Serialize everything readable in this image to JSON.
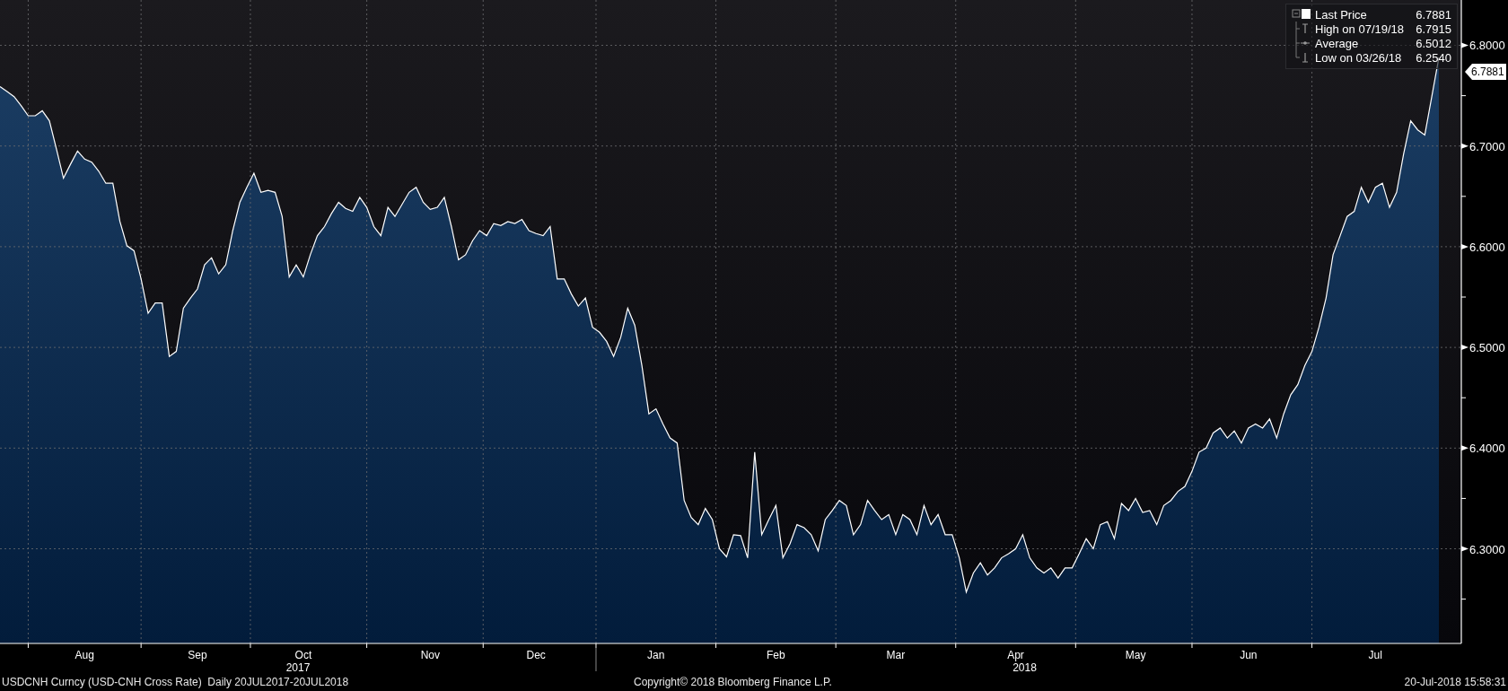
{
  "chart": {
    "legend": [
      {
        "kind": "last",
        "value": "6.7881"
      },
      {
        "kind": "high",
        "label": "High on 07/19/18",
        "value": "6.7915"
      },
      {
        "kind": "average",
        "label": "Average",
        "value": "6.5012"
      },
      {
        "kind": "low",
        "label": "Low on 03/26/18",
        "value": "6.2540"
      }
    ],
    "price_tag": "6.7881",
    "chart_data": {
      "type": "area",
      "grid": true,
      "ylim": [
        6.206,
        6.845
      ],
      "categories": [
        null,
        null,
        null,
        null,
        null,
        null,
        null,
        null,
        null,
        null,
        null,
        null,
        "Aug",
        null,
        null,
        null,
        null,
        null,
        null,
        null,
        null,
        null,
        null,
        null,
        null,
        null,
        null,
        null,
        "Sep",
        null,
        null,
        null,
        null,
        null,
        null,
        null,
        null,
        null,
        null,
        null,
        null,
        null,
        null,
        "Oct",
        null,
        null,
        null,
        null,
        null,
        null,
        null,
        null,
        null,
        null,
        null,
        null,
        null,
        null,
        null,
        null,
        null,
        "Nov",
        null,
        null,
        null,
        null,
        null,
        null,
        null,
        null,
        null,
        null,
        null,
        null,
        null,
        null,
        "Dec",
        null,
        null,
        null,
        null,
        null,
        null,
        null,
        null,
        null,
        null,
        null,
        null,
        null,
        null,
        null,
        null,
        "Jan",
        null,
        null,
        null,
        null,
        null,
        null,
        null,
        null,
        null,
        null,
        null,
        null,
        null,
        null,
        null,
        null,
        "Feb",
        null,
        null,
        null,
        null,
        null,
        null,
        null,
        null,
        null,
        null,
        null,
        null,
        null,
        null,
        null,
        null,
        "Mar",
        null,
        null,
        null,
        null,
        null,
        null,
        null,
        null,
        null,
        null,
        null,
        null,
        null,
        null,
        null,
        null,
        "Apr",
        null,
        null,
        null,
        null,
        null,
        null,
        null,
        null,
        null,
        null,
        null,
        null,
        null,
        null,
        null,
        null,
        "May",
        null,
        null,
        null,
        null,
        null,
        null,
        null,
        null,
        null,
        null,
        null,
        null,
        null,
        null,
        null,
        "Jun",
        null,
        null,
        null,
        null,
        null,
        null,
        null,
        null,
        null,
        null,
        null,
        null,
        null,
        null,
        null,
        null,
        null,
        "Jul",
        null,
        null,
        null,
        null,
        null,
        null,
        null,
        null,
        null
      ],
      "yticks": [
        {
          "value": 6.3,
          "label": "6.3000"
        },
        {
          "value": 6.4,
          "label": "6.4000"
        },
        {
          "value": 6.5,
          "label": "6.5000"
        },
        {
          "value": 6.6,
          "label": "6.6000"
        },
        {
          "value": 6.7,
          "label": "6.7000"
        },
        {
          "value": 6.8,
          "label": "6.8000"
        }
      ],
      "annotations": [
        "2017",
        "2018"
      ],
      "series": [
        {
          "name": "Last Price",
          "color": "#ffffff",
          "values": [
            6.759,
            6.754,
            6.749,
            6.74,
            6.73,
            6.73,
            6.735,
            6.725,
            6.697,
            6.668,
            6.682,
            6.695,
            6.687,
            6.684,
            6.675,
            6.663,
            6.663,
            6.625,
            6.601,
            6.596,
            6.568,
            6.534,
            6.544,
            6.544,
            6.491,
            6.496,
            6.539,
            6.549,
            6.558,
            6.582,
            6.589,
            6.573,
            6.582,
            6.616,
            6.644,
            6.659,
            6.673,
            6.654,
            6.656,
            6.654,
            6.63,
            6.57,
            6.582,
            6.57,
            6.592,
            6.611,
            6.62,
            6.633,
            6.644,
            6.638,
            6.635,
            6.649,
            6.639,
            6.62,
            6.611,
            6.639,
            6.63,
            6.642,
            6.654,
            6.659,
            6.644,
            6.637,
            6.639,
            6.649,
            6.62,
            6.587,
            6.592,
            6.606,
            6.616,
            6.611,
            6.623,
            6.621,
            6.625,
            6.623,
            6.627,
            6.616,
            6.613,
            6.611,
            6.62,
            6.568,
            6.568,
            6.553,
            6.541,
            6.549,
            6.52,
            6.515,
            6.506,
            6.491,
            6.51,
            6.539,
            6.522,
            6.482,
            6.434,
            6.439,
            6.424,
            6.41,
            6.405,
            6.348,
            6.331,
            6.324,
            6.34,
            6.329,
            6.3,
            6.292,
            6.314,
            6.313,
            6.291,
            6.396,
            6.314,
            6.329,
            6.343,
            6.291,
            6.305,
            6.324,
            6.321,
            6.314,
            6.298,
            6.329,
            6.338,
            6.348,
            6.343,
            6.314,
            6.324,
            6.348,
            6.338,
            6.329,
            6.334,
            6.314,
            6.334,
            6.329,
            6.314,
            6.343,
            6.324,
            6.334,
            6.314,
            6.314,
            6.291,
            6.257,
            6.276,
            6.286,
            6.274,
            6.281,
            6.291,
            6.295,
            6.3,
            6.314,
            6.291,
            6.281,
            6.276,
            6.281,
            6.271,
            6.281,
            6.281,
            6.295,
            6.31,
            6.3,
            6.324,
            6.327,
            6.31,
            6.345,
            6.338,
            6.35,
            6.336,
            6.338,
            6.324,
            6.343,
            6.348,
            6.357,
            6.362,
            6.377,
            6.396,
            6.4,
            6.415,
            6.42,
            6.41,
            6.417,
            6.405,
            6.42,
            6.424,
            6.42,
            6.429,
            6.41,
            6.434,
            6.453,
            6.463,
            6.482,
            6.496,
            6.52,
            6.549,
            6.592,
            6.611,
            6.63,
            6.635,
            6.659,
            6.644,
            6.659,
            6.663,
            6.639,
            6.654,
            6.692,
            6.725,
            6.716,
            6.711,
            6.749,
            6.788
          ]
        }
      ]
    }
  },
  "footer": {
    "description": "USDCNH Curncy (USD-CNH Cross Rate)  Daily 20JUL2017-20JUL2018",
    "copyright": "Copyright© 2018 Bloomberg Finance L.P.",
    "timestamp": "20-Jul-2018 15:58:31"
  }
}
